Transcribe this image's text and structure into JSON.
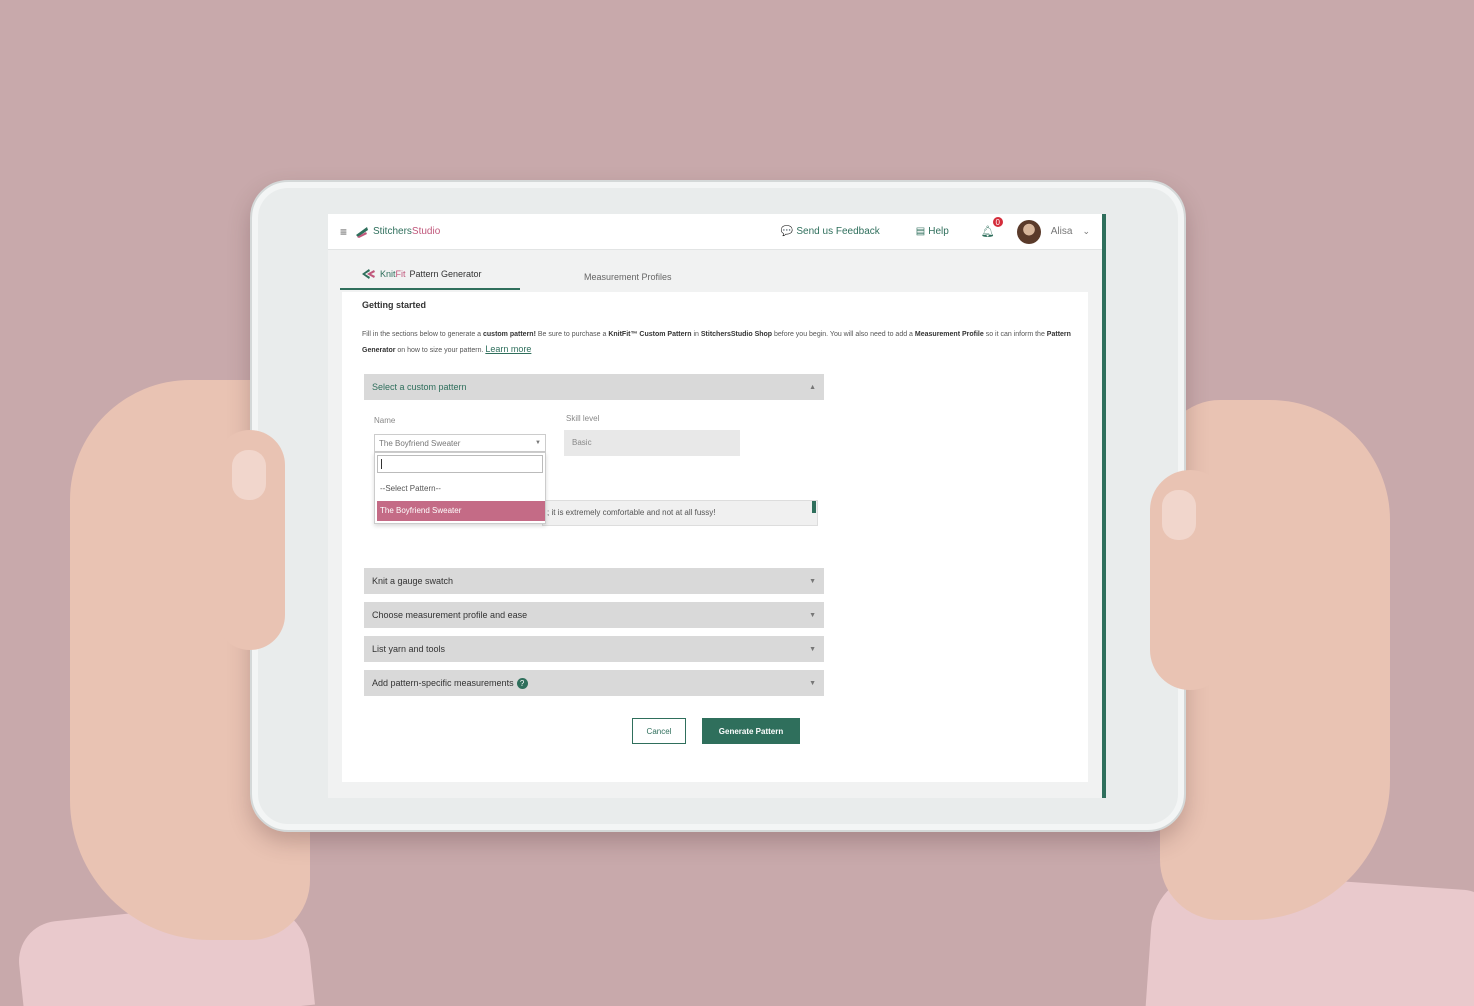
{
  "app": {
    "brand_main": "Stitchers",
    "brand_accent": "Studio",
    "menu_icon": "hamburger-icon"
  },
  "topbar": {
    "feedback": "Send us Feedback",
    "help": "Help",
    "notification_count": "0",
    "user_name": "Alisa"
  },
  "tabs": {
    "knitfit_main": "Knit",
    "knitfit_accent": "Fit",
    "pattern_generator": "Pattern Generator",
    "measurement_profiles": "Measurement Profiles"
  },
  "main": {
    "title": "Getting started",
    "intro_1": "Fill in the sections below to generate a ",
    "intro_bold_1": "custom pattern!",
    "intro_2": " Be sure to purchase a ",
    "intro_bold_2": "KnitFit™ Custom Pattern",
    "intro_3": " in ",
    "intro_bold_3": "StitchersStudio Shop",
    "intro_4": " before you begin. You will also need to add a ",
    "intro_bold_4": "Measurement Profile",
    "intro_5": " so it can inform the ",
    "intro_bold_5": "Pattern Generator",
    "intro_6": " on how to size your pattern. ",
    "learn_more": "Learn more"
  },
  "sections": {
    "select_pattern": "Select a custom pattern",
    "gauge": "Knit a gauge swatch",
    "measurement": "Choose measurement profile and ease",
    "yarn": "List yarn and tools",
    "specific": "Add pattern-specific measurements"
  },
  "form": {
    "name_label": "Name",
    "name_value": "The Boyfriend Sweater",
    "skill_label": "Skill level",
    "skill_value": "Basic",
    "dropdown_placeholder": "--Select Pattern--",
    "dropdown_selected": "The Boyfriend Sweater",
    "description_text": "; it is extremely comfortable and not at all fussy!"
  },
  "actions": {
    "cancel": "Cancel",
    "generate": "Generate Pattern"
  },
  "colors": {
    "brand_green": "#2f6f5c",
    "brand_pink": "#c0577b",
    "selected_option": "#c46b86",
    "background": "#c8a9ab"
  }
}
